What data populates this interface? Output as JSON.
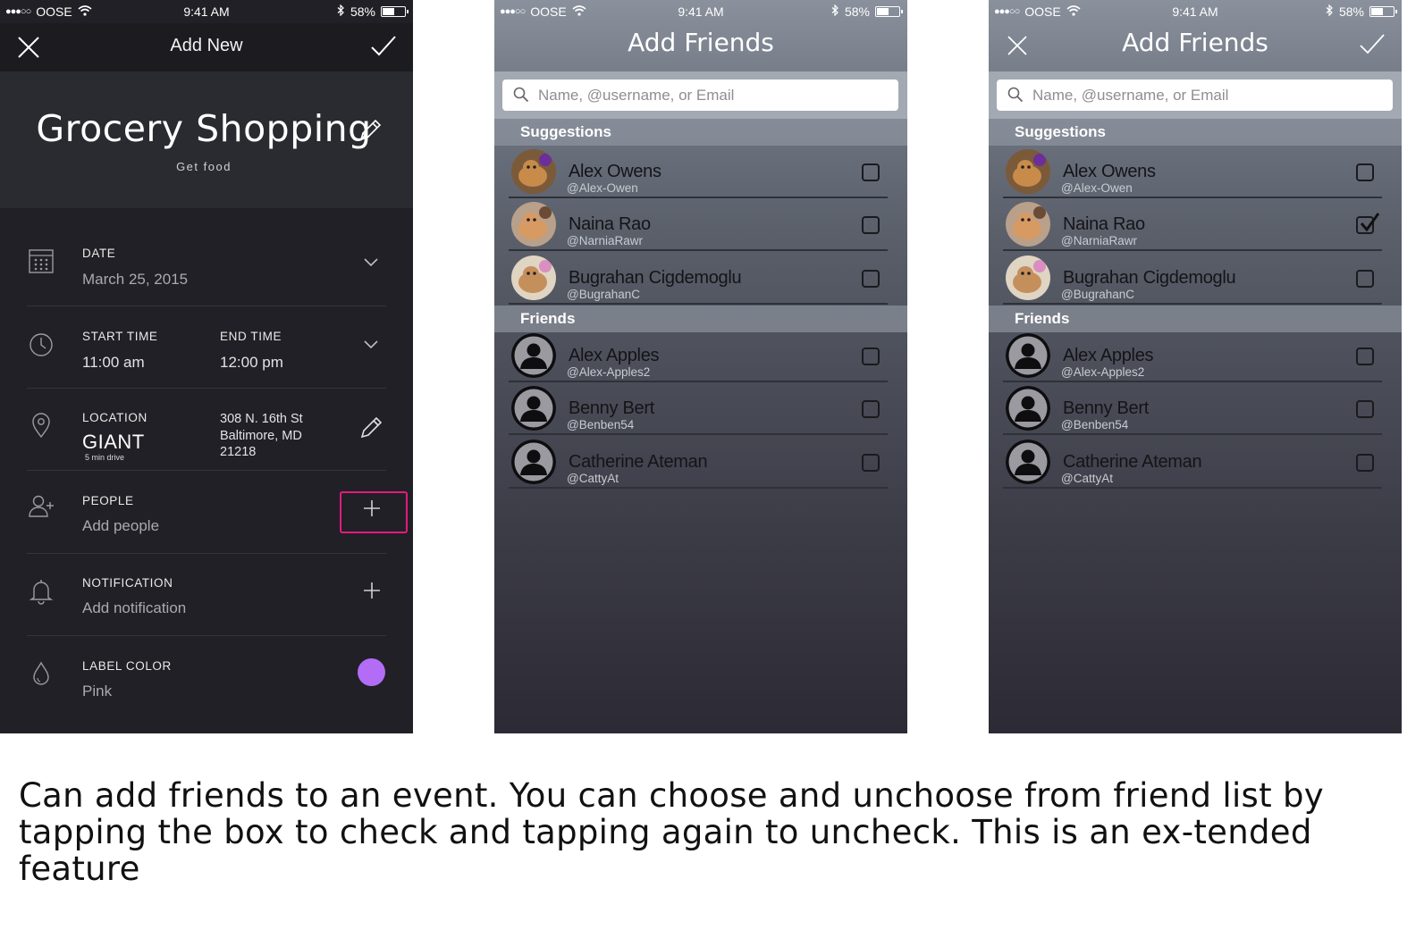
{
  "statusbar": {
    "carrier": "OOSE",
    "time": "9:41 AM",
    "battery": "58%",
    "battery_level": 0.58
  },
  "add_new": {
    "header": {
      "title": "Add New",
      "cancel_icon": "close-icon",
      "confirm_icon": "checkmark-icon"
    },
    "event": {
      "title": "Grocery Shopping",
      "subtitle": "Get food"
    },
    "date": {
      "label": "DATE",
      "value": "March 25, 2015"
    },
    "time": {
      "start_label": "START TIME",
      "start_value": "11:00 am",
      "end_label": "END TIME",
      "end_value": "12:00 pm"
    },
    "location": {
      "label": "LOCATION",
      "name": "GIANT",
      "drive": "5 min drive",
      "addr1": "308 N. 16th St",
      "addr2": "Baltimore, MD",
      "addr3": "21218"
    },
    "people": {
      "label": "PEOPLE",
      "value": "Add people"
    },
    "notification": {
      "label": "NOTIFICATION",
      "value": "Add notification"
    },
    "label_color": {
      "label": "LABEL COLOR",
      "value": "Pink",
      "swatch": "#b36cf5"
    },
    "highlight_color": "#e6197f"
  },
  "add_friends": {
    "title": "Add Friends",
    "search_placeholder": "Name, @username, or Email",
    "suggestions_header": "Suggestions",
    "friends_header": "Friends",
    "suggestions": [
      {
        "name": "Alex Owens",
        "handle": "@Alex-Owen"
      },
      {
        "name": "Naina Rao",
        "handle": "@NarniaRawr"
      },
      {
        "name": "Bugrahan Cigdemoglu",
        "handle": "@BugrahanC"
      }
    ],
    "friends": [
      {
        "name": "Alex Apples",
        "handle": "@Alex-Apples2"
      },
      {
        "name": "Benny Bert",
        "handle": "@Benben54"
      },
      {
        "name": "Catherine Ateman",
        "handle": "@CattyAt"
      }
    ],
    "screen3_checked": [
      "Naina Rao"
    ]
  },
  "caption": "Can add friends to an event. You can choose and unchoose from friend list by tapping the box to check and tapping again to uncheck. This is an ex-tended feature"
}
